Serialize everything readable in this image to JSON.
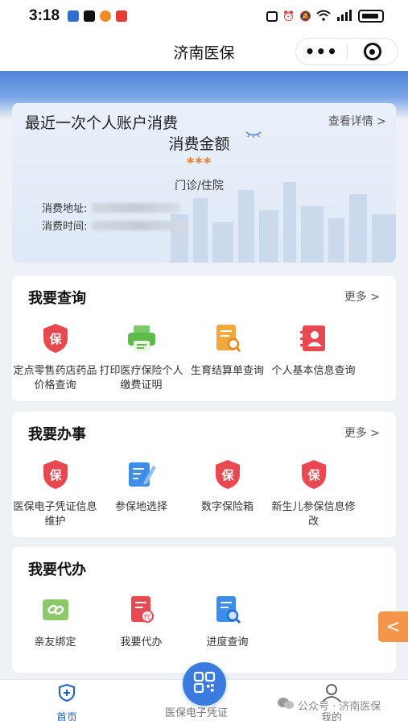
{
  "status_bar": {
    "time": "3:18"
  },
  "nav": {
    "title": "济南医保",
    "more_glyph": "•••"
  },
  "recent": {
    "title": "最近一次个人账户消费",
    "detail_link": "查看详情 >",
    "amount_label": "消费金额",
    "amount": "***",
    "type": "门诊/住院",
    "address_label": "消费地址:",
    "time_label": "消费时间:"
  },
  "query": {
    "title": "我要查询",
    "more": "更多 >",
    "items": [
      {
        "label": "定点零售药店药品价格查询",
        "icon": "shield-bao-icon"
      },
      {
        "label": "打印医疗保险个人缴费证明",
        "icon": "printer-icon"
      },
      {
        "label": "生育结算单查询",
        "icon": "document-search-icon"
      },
      {
        "label": "个人基本信息查询",
        "icon": "id-card-icon"
      }
    ]
  },
  "handle": {
    "title": "我要办事",
    "more": "更多 >",
    "items": [
      {
        "label": "医保电子凭证信息维护",
        "icon": "shield-bao-icon"
      },
      {
        "label": "参保地选择",
        "icon": "edit-document-icon"
      },
      {
        "label": "数字保险箱",
        "icon": "shield-bao-icon"
      },
      {
        "label": "新生儿参保信息修改",
        "icon": "shield-bao-icon"
      }
    ]
  },
  "agent": {
    "title": "我要代办",
    "items": [
      {
        "label": "亲友绑定",
        "icon": "link-icon"
      },
      {
        "label": "我要代办",
        "icon": "proxy-document-icon"
      },
      {
        "label": "进度查询",
        "icon": "progress-search-icon"
      }
    ]
  },
  "float_tab": {
    "glyph": "<"
  },
  "tabbar": {
    "home": "首页",
    "voucher": "医保电子凭证",
    "mine": "我的"
  },
  "watermark": "公众号 · 济南医保",
  "colors": {
    "brand_blue": "#3b7be0",
    "accent_orange": "#f07a2a",
    "icon_red": "#e8484f",
    "icon_green": "#5dbb4a",
    "icon_yellow": "#f2a93b"
  }
}
